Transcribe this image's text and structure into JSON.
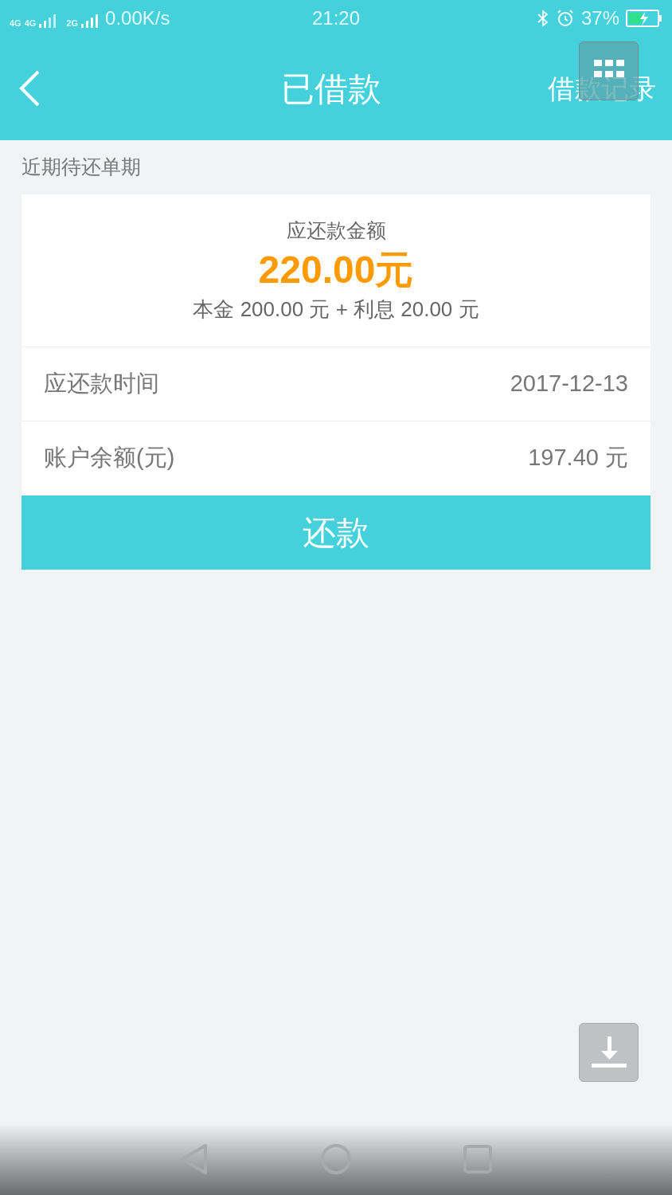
{
  "status_bar": {
    "network_1": "4G",
    "network_2": "4G",
    "network_3": "2G",
    "speed": "0.00K/s",
    "time": "21:20",
    "battery": "37%"
  },
  "header": {
    "title": "已借款",
    "action": "借款记录"
  },
  "section_label": "近期待还单期",
  "summary": {
    "label": "应还款金额",
    "amount": "220.00元",
    "breakdown": "本金 200.00 元 + 利息 20.00 元"
  },
  "rows": [
    {
      "label": "应还款时间",
      "value": "2017-12-13"
    },
    {
      "label": "账户余额(元)",
      "value": "197.40 元"
    }
  ],
  "repay_button": "还款"
}
